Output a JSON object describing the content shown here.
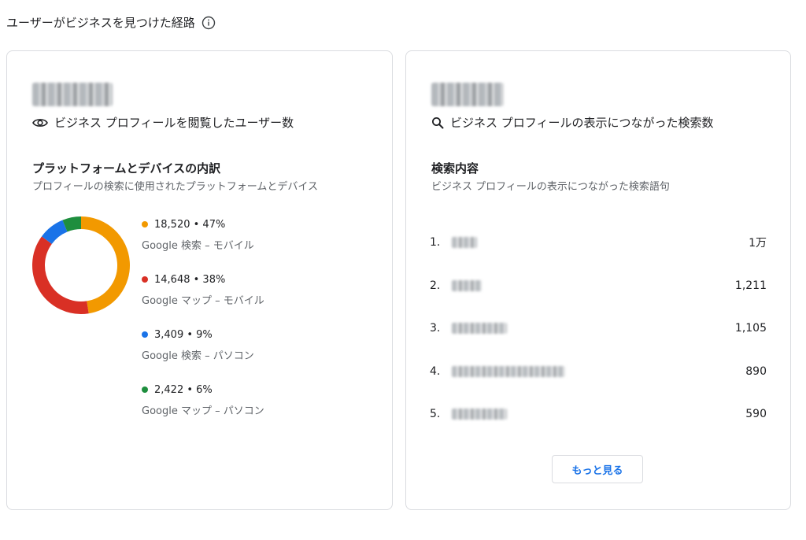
{
  "page": {
    "title": "ユーザーがビジネスを見つけた経路",
    "info_icon": "info-icon"
  },
  "views_card": {
    "metric_label": "ビジネス プロフィールを閲覧したユーザー数",
    "metric_icon": "eye-icon",
    "breakdown_title": "プラットフォームとデバイスの内訳",
    "breakdown_subtitle": "プロフィールの検索に使用されたプラットフォームとデバイス"
  },
  "chart_data": {
    "type": "pie",
    "variant": "donut",
    "slices": [
      {
        "value_text": "18,520 • 47%",
        "value": 18520,
        "percent": 47,
        "name": "Google 検索 – モバイル",
        "color": "#f29900"
      },
      {
        "value_text": "14,648 • 38%",
        "value": 14648,
        "percent": 38,
        "name": "Google マップ – モバイル",
        "color": "#d93025"
      },
      {
        "value_text": "3,409 • 9%",
        "value": 3409,
        "percent": 9,
        "name": "Google 検索 – パソコン",
        "color": "#1a73e8"
      },
      {
        "value_text": "2,422 • 6%",
        "value": 2422,
        "percent": 6,
        "name": "Google マップ – パソコン",
        "color": "#1e8e3e"
      }
    ]
  },
  "searches_card": {
    "metric_label": "ビジネス プロフィールの表示につながった検索数",
    "metric_icon": "search-icon",
    "section_title": "検索内容",
    "section_subtitle": "ビジネス プロフィールの表示につながった検索語句",
    "rows": [
      {
        "rank": "1.",
        "count": "1万"
      },
      {
        "rank": "2.",
        "count": "1,211"
      },
      {
        "rank": "3.",
        "count": "1,105"
      },
      {
        "rank": "4.",
        "count": "890"
      },
      {
        "rank": "5.",
        "count": "590"
      }
    ],
    "more_button": "もっと見る"
  }
}
